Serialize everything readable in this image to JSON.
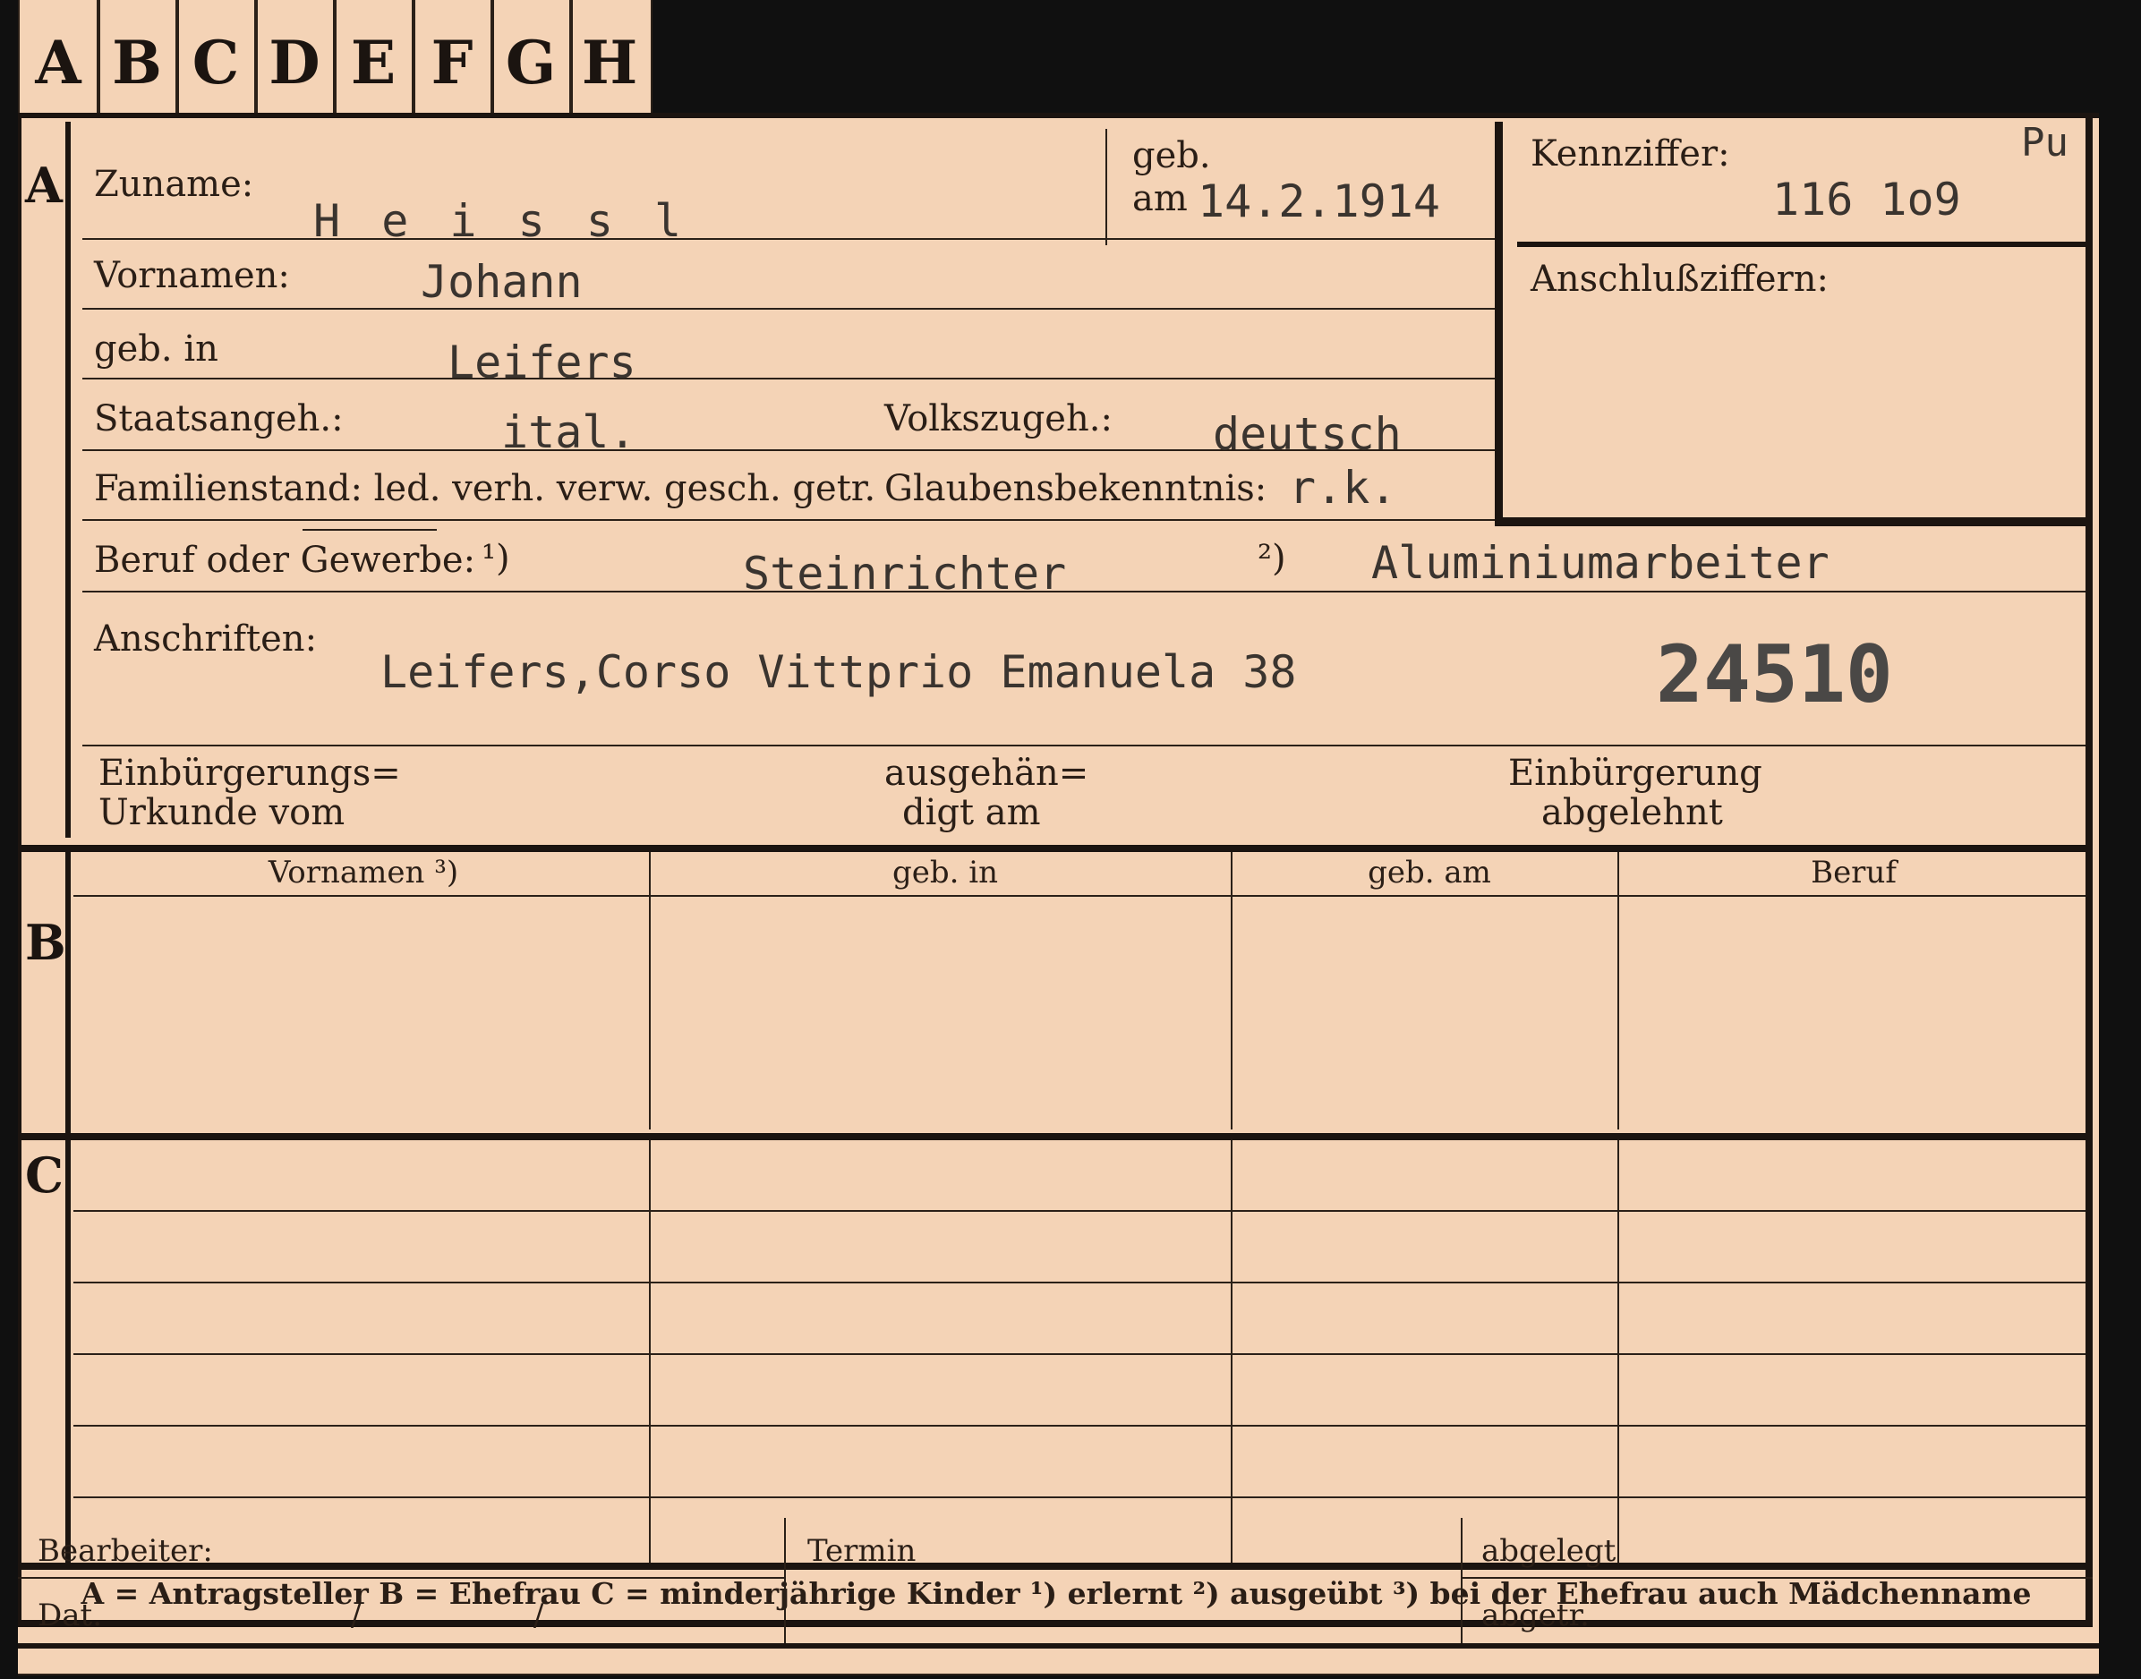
{
  "tabs": [
    "A",
    "B",
    "C",
    "D",
    "E",
    "F",
    "G",
    "H"
  ],
  "sections": {
    "a": "A",
    "b": "B",
    "c": "C"
  },
  "labels": {
    "zuname": "Zuname:",
    "geb": "geb.",
    "geb_am": "am",
    "kennziffer": "Kennziffer:",
    "anschluss": "Anschlußziffern:",
    "vornamen": "Vornamen:",
    "geb_in": "geb. in",
    "staatsangeh": "Staatsangeh.:",
    "volkszugeh": "Volkszugeh.:",
    "familienstand": "Familienstand: led. verh. verw. gesch. getr.",
    "glaubens": "Glaubensbekenntnis:",
    "beruf": "Beruf oder Gewerbe:",
    "fn1": "¹)",
    "fn2": "²)",
    "anschriften": "Anschriften:",
    "einb_urkunde_1": "Einbürgerungs=",
    "einb_urkunde_2": "Urkunde vom",
    "ausgehaend_1": "ausgehän=",
    "ausgehaend_2": "digt am",
    "einb_abgelehnt_1": "Einbürgerung",
    "einb_abgelehnt_2": "abgelehnt"
  },
  "values": {
    "zuname": "H e i s s l",
    "geb_datum": "14.2.1914",
    "pu": "Pu",
    "kennziffer": "116 1o9",
    "vornamen": "Johann",
    "geburtsort": "Leifers",
    "staatsangeh": "ital.",
    "volkszugeh": "deutsch",
    "glaubens": "r.k.",
    "beruf_erlernt": "Steinrichter",
    "beruf_ausgeuebt": "Aluminiumarbeiter",
    "anschrift": "Leifers,Corso Vittprio Emanuela 38",
    "stamp_number": "24510"
  },
  "table_headers": [
    "Vornamen ³)",
    "geb. in",
    "geb. am",
    "Beruf"
  ],
  "legend": "A = Antragsteller   B = Ehefrau   C = minderjährige Kinder   ¹) erlernt   ²) ausgeübt   ³) bei der Ehefrau auch Mädchenname",
  "footer": {
    "bearbeiter": "Bearbeiter:",
    "termin": "Termin",
    "abgelegt": "abgelegt",
    "dat": "Dat.",
    "slash1": "/",
    "slash2": "/",
    "abgetr": "abgetr."
  }
}
